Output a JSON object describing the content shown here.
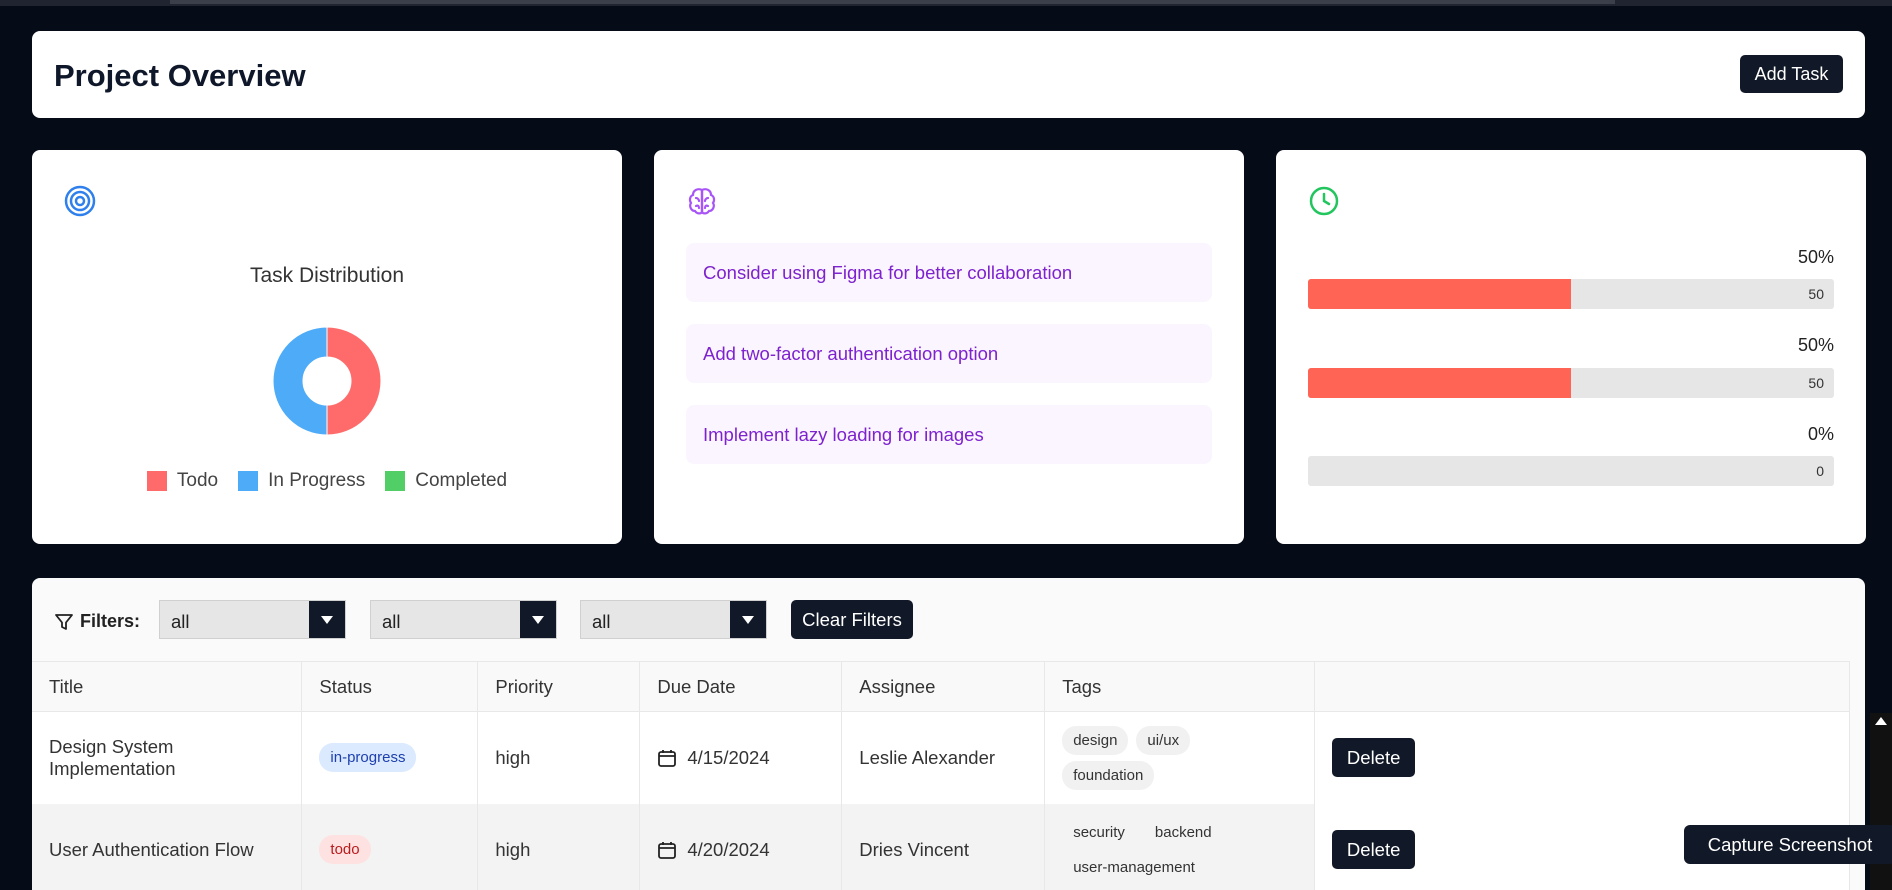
{
  "header": {
    "title": "Project Overview",
    "add_task_label": "Add Task"
  },
  "distribution_card": {
    "icon": "target-icon",
    "chart_data": {
      "type": "pie",
      "title": "Task Distribution",
      "categories": [
        "Todo",
        "In Progress",
        "Completed"
      ],
      "values": [
        1,
        1,
        0
      ],
      "colors": [
        "#ff6b6b",
        "#4dabf7",
        "#51cf66"
      ],
      "donut": true,
      "legend": "bottom"
    }
  },
  "suggestions_card": {
    "icon": "brain-icon",
    "items": [
      "Consider using Figma for better collaboration",
      "Add two-factor authentication option",
      "Implement lazy loading for images"
    ]
  },
  "progress_card": {
    "icon": "clock-icon",
    "bars": [
      {
        "percent_label": "50%",
        "value_label": "50",
        "value": 50
      },
      {
        "percent_label": "50%",
        "value_label": "50",
        "value": 50
      },
      {
        "percent_label": "0%",
        "value_label": "0",
        "value": 0
      }
    ]
  },
  "filters": {
    "label": "Filters:",
    "selects": [
      "all",
      "all",
      "all"
    ],
    "clear_label": "Clear Filters"
  },
  "table": {
    "columns": [
      "Title",
      "Status",
      "Priority",
      "Due Date",
      "Assignee",
      "Tags",
      ""
    ],
    "rows": [
      {
        "title": "Design System Implementation",
        "status": "in-progress",
        "priority": "high",
        "due": "4/15/2024",
        "assignee": "Leslie Alexander",
        "tags": [
          "design",
          "ui/ux",
          "foundation"
        ],
        "delete_label": "Delete"
      },
      {
        "title": "User Authentication Flow",
        "status": "todo",
        "priority": "high",
        "due": "4/20/2024",
        "assignee": "Dries Vincent",
        "tags": [
          "security",
          "backend",
          "user-management"
        ],
        "delete_label": "Delete"
      }
    ]
  },
  "capture_label": "Capture Screenshot",
  "colors": {
    "background": "#050b17",
    "dark_button": "#111827",
    "progress_fill": "#ff6454",
    "suggestion_text": "#7e22ce",
    "in_progress_badge_bg": "#dbeafe",
    "todo_badge_bg": "#fee2e2"
  }
}
